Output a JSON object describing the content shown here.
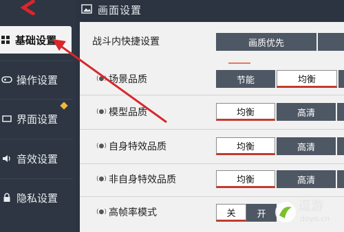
{
  "header": {
    "title": "画面设置"
  },
  "sidebar": {
    "items": [
      {
        "label": "基础设置",
        "icon": "grid-icon"
      },
      {
        "label": "操作设置",
        "icon": "gamepad-icon"
      },
      {
        "label": "界面设置",
        "icon": "screen-icon"
      },
      {
        "label": "音效设置",
        "icon": "speaker-icon"
      },
      {
        "label": "隐私设置",
        "icon": "lock-icon"
      }
    ],
    "active_index": 0
  },
  "settings": {
    "quick_settings": {
      "label": "战斗内快捷设置",
      "options": [
        "画质优先"
      ]
    },
    "scene_quality": {
      "label": "场景品质",
      "options": [
        "节能",
        "均衡"
      ],
      "selected": "均衡"
    },
    "model_quality": {
      "label": "模型品质",
      "options": [
        "均衡",
        "高清"
      ],
      "selected": "均衡"
    },
    "self_effects": {
      "label": "自身特效品质",
      "options": [
        "均衡",
        "高清"
      ],
      "selected": "均衡"
    },
    "other_effects": {
      "label": "非自身特效品质",
      "options": [
        "均衡",
        "高清"
      ],
      "selected": "均衡"
    },
    "high_fps": {
      "label": "高帧率模式",
      "options": [
        "关",
        "开"
      ],
      "selected": "关"
    }
  },
  "watermark": {
    "brand": "逗游",
    "site": "doyo.cn"
  },
  "colors": {
    "accent_red": "#c23a2c",
    "annotation_red": "#d9262b",
    "segment_dark": "#4e5864",
    "panel_bg": "#f1f1f1",
    "sidebar_bg": "#2d3642"
  }
}
